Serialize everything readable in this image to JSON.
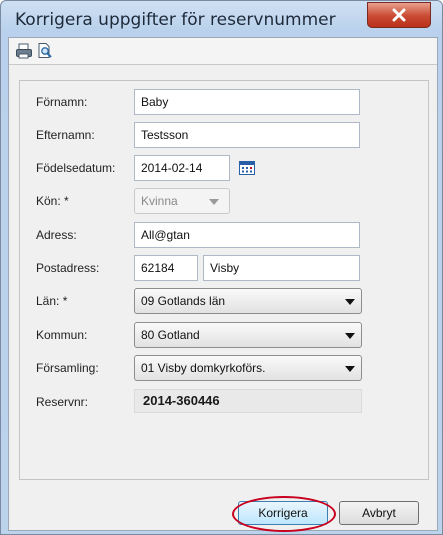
{
  "window": {
    "title": "Korrigera uppgifter för reservnummer"
  },
  "toolbar": {
    "icons": [
      "print-icon",
      "print-preview-icon"
    ]
  },
  "form": {
    "fornamn": {
      "label": "Förnamn:",
      "value": "Baby"
    },
    "efternamn": {
      "label": "Efternamn:",
      "value": "Testsson"
    },
    "fodelsedatum": {
      "label": "Födelsedatum:",
      "value": "2014-02-14"
    },
    "kon": {
      "label": "Kön: *",
      "value": "Kvinna"
    },
    "adress": {
      "label": "Adress:",
      "value": "All@gtan"
    },
    "postadress": {
      "label": "Postadress:",
      "postnummer": "62184",
      "ort": "Visby"
    },
    "lan": {
      "label": "Län: *",
      "value": "09 Gotlands län"
    },
    "kommun": {
      "label": "Kommun:",
      "value": "80 Gotland"
    },
    "forsamling": {
      "label": "Församling:",
      "value": "01 Visby domkyrkoförs."
    },
    "reservnr": {
      "label": "Reservnr:",
      "value": "2014-360446"
    }
  },
  "buttons": {
    "korrigera": "Korrigera",
    "avbryt": "Avbryt"
  },
  "colors": {
    "highlight": "#c8001e",
    "close": "#c94a33"
  }
}
